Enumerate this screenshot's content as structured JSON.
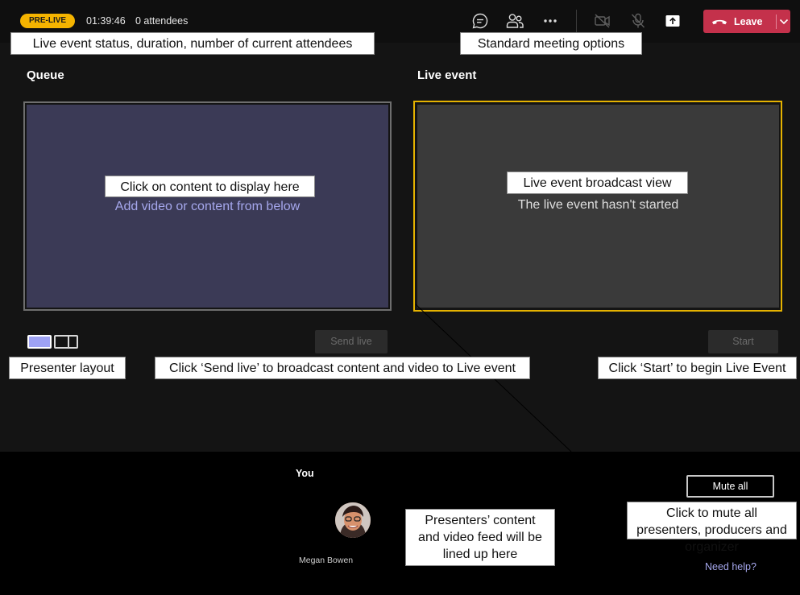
{
  "topbar": {
    "status_badge": "PRE-LIVE",
    "duration": "01:39:46",
    "attendees": "0 attendees",
    "icons": [
      "chat-icon",
      "participants-icon",
      "more-options-icon",
      "camera-off-icon",
      "mic-off-icon",
      "share-screen-icon"
    ],
    "leave_label": "Leave"
  },
  "queue": {
    "title": "Queue",
    "placeholder": "Add video or content from below",
    "send_live_label": "Send live"
  },
  "live_event": {
    "title": "Live event",
    "status_text": "The live event hasn't started",
    "start_label": "Start"
  },
  "presenters": {
    "you_label": "You",
    "presenter_name": "Megan Bowen",
    "mute_all_label": "Mute all",
    "need_help_label": "Need help?"
  },
  "annotations": {
    "status": "Live event status, duration, number of current attendees",
    "meeting_options": "Standard meeting options",
    "queue_content": "Click on content to display here",
    "broadcast_view": "Live event broadcast view",
    "presenter_layout": "Presenter layout",
    "send_live": "Click ‘Send live’ to broadcast content and video to Live event",
    "start": "Click ‘Start’ to begin Live Event",
    "lined_up": "Presenters’ content and video feed will be lined up here",
    "mute_all": "Click to mute all presenters, producers and organizer"
  },
  "colors": {
    "badge": "#f5b400",
    "leave": "#c4314b",
    "queue_panel": "#3b3a56",
    "live_border": "#e5b200",
    "link": "#a5a7ec"
  }
}
